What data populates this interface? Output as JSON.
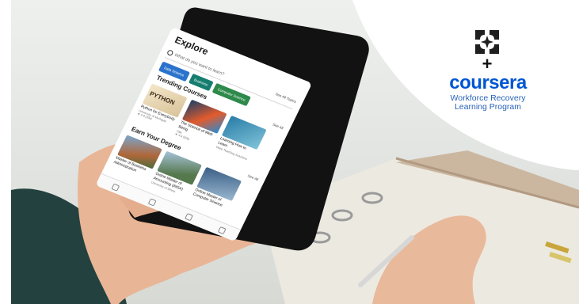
{
  "app": {
    "screen_title": "Explore",
    "search_placeholder": "What do you want to learn?",
    "search_link": "See All Topics",
    "chips": [
      "Data Science",
      "Business",
      "Computer Science"
    ],
    "trending_title": "Trending Courses",
    "trending_link": "See All",
    "trending_cards": [
      {
        "thumb_text": "PYTHON",
        "name": "Python for Everybody",
        "meta": "University of Michigan",
        "rating": "★ 4.8 (30k)"
      },
      {
        "name": "The Science of Well-Being",
        "meta": "Yale",
        "rating": "★ 4.9 (50k)"
      },
      {
        "name": "Learning How to Learn",
        "meta": "Deep Teaching Solutions",
        "rating": ""
      }
    ],
    "degree_title": "Earn Your Degree",
    "degree_link": "See All",
    "degree_cards": [
      {
        "name": "Master of Business Administration",
        "meta": ""
      },
      {
        "name": "Online Master of Accounting (iMSA)",
        "meta": "University of Illinois"
      },
      {
        "name": "Online Master of Computer Science",
        "meta": ""
      }
    ]
  },
  "logo": {
    "wordmark": "coursera",
    "plus": "+",
    "tagline_line1": "Workforce Recovery",
    "tagline_line2": "Learning Program",
    "colors": {
      "brand_blue": "#0056d2",
      "tagline_blue": "#2a63b8",
      "mark_dark": "#1f1f1f"
    }
  }
}
